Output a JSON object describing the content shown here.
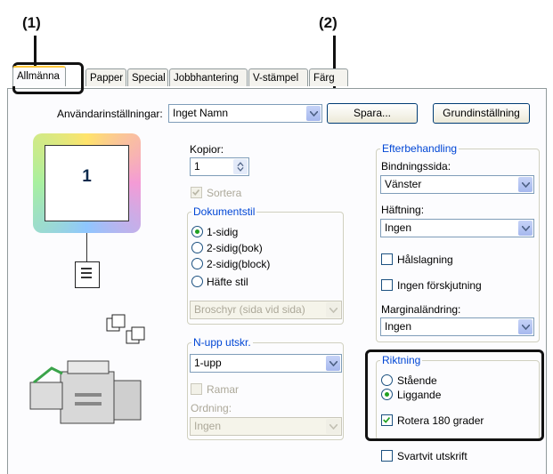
{
  "callouts": {
    "c1": "(1)",
    "c2": "(2)"
  },
  "tabs": [
    "Allmänna",
    "Papper",
    "Special",
    "Jobbhantering",
    "V-stämpel",
    "Färg"
  ],
  "user_settings": {
    "label": "Användarinställningar:",
    "value": "Inget Namn",
    "save": "Spara...",
    "default": "Grundinställning"
  },
  "preview": {
    "page_number": "1"
  },
  "copies": {
    "label": "Kopior:",
    "value": "1",
    "collate": "Sortera"
  },
  "document_style": {
    "title": "Dokumentstil",
    "options": [
      "1-sidig",
      "2-sidig(bok)",
      "2-sidig(block)",
      "Häfte stil"
    ],
    "selected_index": 0,
    "booklet_value": "Broschyr (sida vid sida)"
  },
  "nup": {
    "title": "N-upp utskr.",
    "value": "1-upp",
    "border": "Ramar",
    "order_label": "Ordning:",
    "order_value": "Ingen"
  },
  "finishing": {
    "title": "Efterbehandling",
    "binding_label": "Bindningssida:",
    "binding_value": "Vänster",
    "staple_label": "Häftning:",
    "staple_value": "Ingen",
    "punch": "Hålslagning",
    "offset": "Ingen förskjutning",
    "margin_label": "Marginaländring:",
    "margin_value": "Ingen"
  },
  "orientation": {
    "title": "Riktning",
    "options": [
      "Stående",
      "Liggande"
    ],
    "selected_index": 1,
    "rotate": "Rotera 180 grader",
    "rotate_checked": true
  },
  "bw_print": "Svartvit utskrift",
  "colors": {
    "accent_green": "#21a121",
    "group_title": "#0046d5",
    "tab_highlight": "#ffc83c"
  }
}
